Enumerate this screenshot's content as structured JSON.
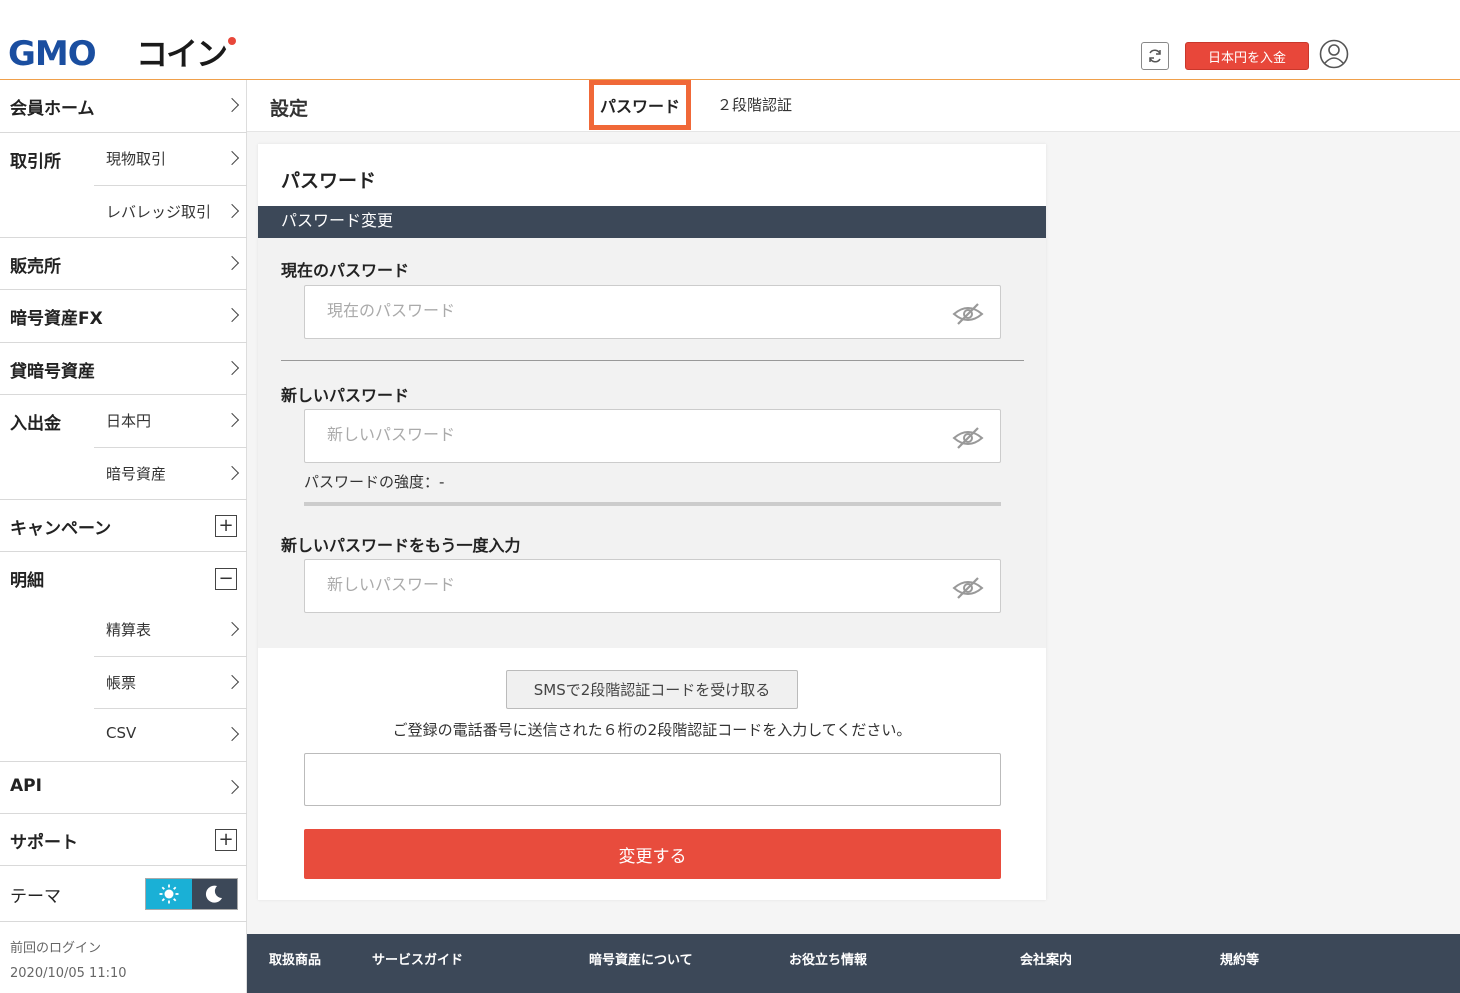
{
  "header": {
    "logo_text": "GMOコイン",
    "deposit_button": "日本円を入金",
    "accent_color": "#e8473a"
  },
  "sidebar": {
    "home": "会員ホーム",
    "exchange": {
      "label": "取引所",
      "items": [
        "現物取引",
        "レバレッジ取引"
      ]
    },
    "sales": "販売所",
    "crypto_fx": "暗号資産FX",
    "lending": "貸暗号資産",
    "deposit_withdraw": {
      "label": "入出金",
      "items": [
        "日本円",
        "暗号資産"
      ]
    },
    "campaign": "キャンペーン",
    "details": {
      "label": "明細",
      "items": [
        "精算表",
        "帳票",
        "CSV"
      ]
    },
    "api": "API",
    "support": "サポート",
    "theme": "テーマ",
    "last_login_label": "前回のログイン",
    "last_login_value": "2020/10/05 11:10"
  },
  "tabbar": {
    "title": "設定",
    "tab_password": "パスワード",
    "tab_2fa": "２段階認証"
  },
  "card": {
    "title": "パスワード",
    "band": "パスワード変更",
    "current_label": "現在のパスワード",
    "current_placeholder": "現在のパスワード",
    "new_label": "新しいパスワード",
    "new_placeholder": "新しいパスワード",
    "strength": "パスワードの強度：-",
    "confirm_label": "新しいパスワードをもう一度入力",
    "confirm_placeholder": "新しいパスワード",
    "sms_button": "SMSで2段階認証コードを受け取る",
    "sms_note": "ご登録の電話番号に送信された６桁の2段階認証コードを入力してください。",
    "submit": "変更する"
  },
  "footer": {
    "columns": [
      "取扱商品",
      "サービスガイド",
      "暗号資産について",
      "お役立ち情報",
      "会社案内",
      "規約等"
    ]
  }
}
